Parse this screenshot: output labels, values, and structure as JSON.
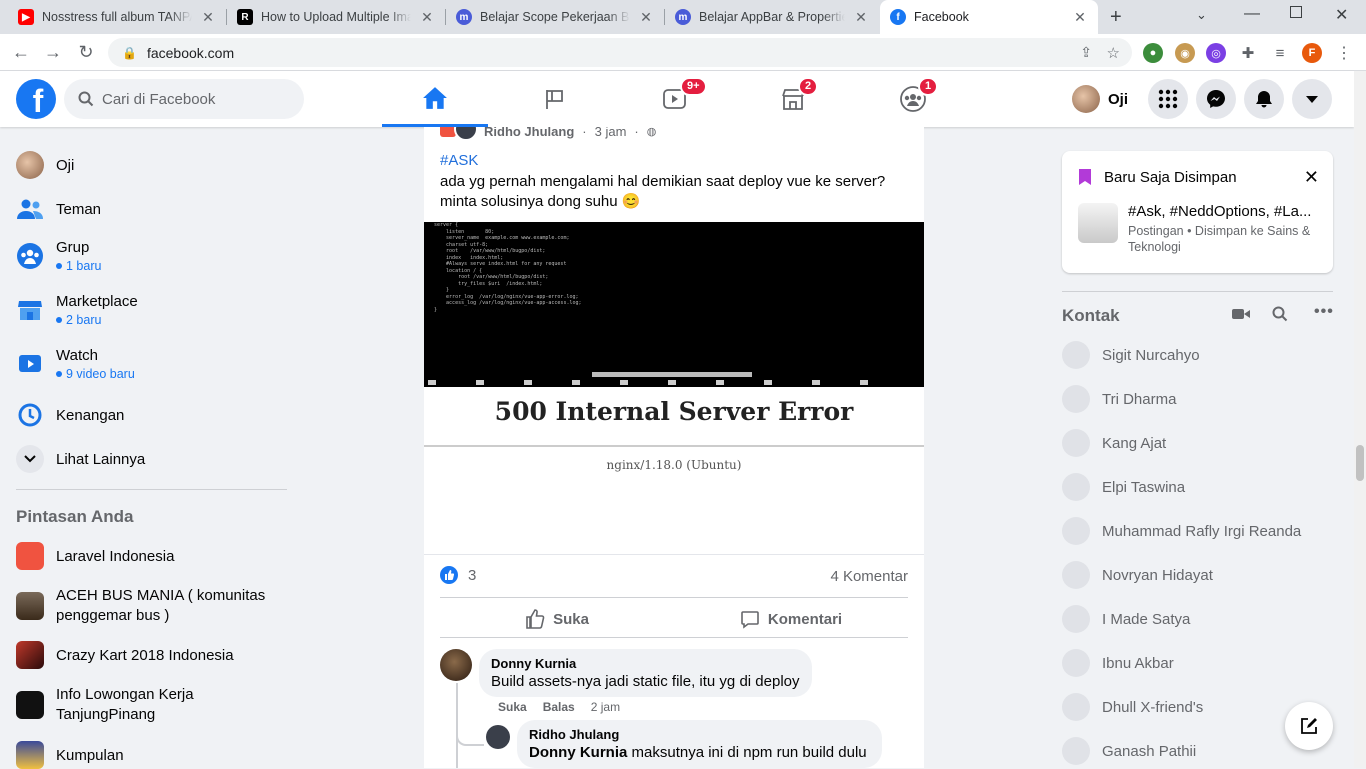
{
  "browser": {
    "tabs": [
      {
        "title": "Nosstress full album TANPA IKLAN",
        "icon_color": "#ff0000"
      },
      {
        "title": "How to Upload Multiple Images",
        "icon_color": "#000000"
      },
      {
        "title": "Belajar Scope Pekerjaan Backend",
        "icon_color": "#4a5cd8"
      },
      {
        "title": "Belajar AppBar & Properties",
        "icon_color": "#4a5cd8"
      },
      {
        "title": "Facebook",
        "icon_color": "#1877f2"
      }
    ],
    "url": "facebook.com",
    "profile_initial": "F"
  },
  "header": {
    "logo": "f",
    "search_placeholder": "Cari di Facebook",
    "badges": {
      "watch": "9+",
      "marketplace": "2",
      "groups": "1"
    },
    "user_name": "Oji"
  },
  "sidebar": {
    "items": [
      {
        "label": "Oji",
        "sub": ""
      },
      {
        "label": "Teman",
        "sub": ""
      },
      {
        "label": "Grup",
        "sub": "1 baru"
      },
      {
        "label": "Marketplace",
        "sub": "2 baru"
      },
      {
        "label": "Watch",
        "sub": "9 video baru"
      },
      {
        "label": "Kenangan",
        "sub": ""
      },
      {
        "label": "Lihat Lainnya",
        "sub": ""
      }
    ],
    "shortcuts_title": "Pintasan Anda",
    "shortcuts": [
      {
        "label": "Laravel Indonesia",
        "color": "#f05340"
      },
      {
        "label": "ACEH BUS MANIA ( komunitas penggemar bus )",
        "color": "#5a4a3a"
      },
      {
        "label": "Crazy Kart 2018 Indonesia",
        "color": "#8a2a1a"
      },
      {
        "label": "Info Lowongan Kerja TanjungPinang",
        "color": "#111111"
      },
      {
        "label": "Kumpulan",
        "color": "#2a3a8a"
      }
    ]
  },
  "post": {
    "author": "Ridho Jhulang",
    "time": "3 jam",
    "hashtag": "#ASK",
    "text_line1": "ada yg pernah mengalami hal demikian saat deploy vue ke server?",
    "text_line2": "minta solusinya dong suhu 😊",
    "image_error_title": "500 Internal Server Error",
    "image_error_sub": "nginx/1.18.0 (Ubuntu)",
    "terminal_lines": [
      "server {",
      "    listen       80;",
      "    server_name  example.com www.example.com;",
      "    charset utf-8;",
      "    root    /var/www/html/bugpo/dist;",
      "    index   index.html;",
      "    #Always serve index.html for any request",
      "    location / {",
      "        root /var/www/html/bugpo/dist;",
      "        try_files $uri  /index.html;",
      "    }",
      "    error_log  /var/log/nginx/vue-app-error.log;",
      "    access_log /var/log/nginx/vue-app-access.log;",
      "}"
    ],
    "like_count": "3",
    "comments_count": "4 Komentar",
    "like_label": "Suka",
    "comment_label": "Komentari",
    "comments": [
      {
        "author": "Donny Kurnia",
        "text": "Build assets-nya jadi static file, itu yg di deploy",
        "like": "Suka",
        "reply": "Balas",
        "time": "2 jam"
      },
      {
        "author": "Ridho Jhulang",
        "mention": "Donny Kurnia",
        "text": "maksutnya ini di npm run build dulu"
      }
    ]
  },
  "saved": {
    "title": "Baru Saja Disimpan",
    "item_title": "#Ask, #NeddOptions, #La...",
    "item_sub": "Postingan • Disimpan ke Sains & Teknologi"
  },
  "contacts": {
    "title": "Kontak",
    "list": [
      "Sigit Nurcahyo",
      "Tri Dharma",
      "Kang Ajat",
      "Elpi Taswina",
      "Muhammad Rafly Irgi Reanda",
      "Novryan Hidayat",
      "I Made Satya",
      "Ibnu Akbar",
      "Dhull X-friend's",
      "Ganash Pathii"
    ]
  }
}
